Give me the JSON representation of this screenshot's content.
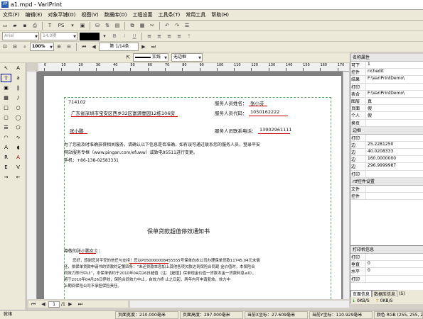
{
  "window": {
    "title": "a1.mpd - VariPrint",
    "icon": "VP"
  },
  "menu": [
    "文件(F)",
    "编辑(E)",
    "对象平铺(O)",
    "视图(V)",
    "数据库(D)",
    "工程设置",
    "工具条(T)",
    "常用工具",
    "帮助(H)"
  ],
  "font": {
    "name": "Arial",
    "size": "14.0磅"
  },
  "nav": {
    "zoom": "100%",
    "page": "第 1/14条"
  },
  "line": {
    "style": "实线",
    "border": "无边框"
  },
  "ruler_marks": [
    "0",
    "10",
    "20",
    "30",
    "40",
    "50",
    "60",
    "70",
    "80",
    "90",
    "100",
    "110",
    "120",
    "130",
    "140",
    "150",
    "160",
    "170"
  ],
  "document": {
    "postal": "714102",
    "address": "广东省深圳市宝安区西乡32区富源壹园12栋106房",
    "customer_name": "张小鹏",
    "service_name_label": "服务人员姓名：",
    "service_name": "张小芬",
    "service_code_label": "服务人员代码：",
    "service_code": "1050162222",
    "service_phone_label": "服务人员联系电话：",
    "service_phone": "13902961111",
    "notice_1": "为了您能及时准确获得相关服务，请确认以下信息是否准确，如有误可通过联系您的服务人员，登录平安",
    "notice_2": "网站服务专框（www.pingan.com/efuww）或致电95511进行变更。",
    "phone_line": "手机：+86-138-02583331",
    "heading": "保单贷款超值停效通知书",
    "salutation_prefix": "尊敬的",
    "salutation_name": "张小鹏",
    "salutation_suffix": "女士：",
    "body_1": "您好，感谢您对平安的信任与支持！您以P050000008455555号保单向本公司办理保单贷款11745.04元未偿",
    "body_2": "还，依保单贷款申请书的贷款约定第四条：“未还贷款本息加上其他各项欠款达到保险合同现 金价值时，本保险合",
    "body_3": "同效力即行中止”，本保单依约于2010年04月26日超值（注：【超值】保单现金价值一贷款本金一贷款利息≤0），",
    "body_4": "将于2010年04月26日停效，保险合同效力中止，自效力终 止之日起，两年内可申请复效，效力中",
    "body_5": "止期间保险公司不承担保险责任。"
  },
  "properties": {
    "section_name": "名称属性",
    "rows1": [
      {
        "k": "可下",
        "v": "1"
      },
      {
        "k": "控件",
        "v": "richedit"
      },
      {
        "k": "结果",
        "v": "F:\\VariPrintDemo\\"
      },
      {
        "k": "打印",
        "v": ""
      },
      {
        "k": "表合",
        "v": "F:\\VariPrintDemo\\"
      },
      {
        "k": "图层",
        "v": "真"
      },
      {
        "k": "页面",
        "v": "假"
      },
      {
        "k": "个人",
        "v": "假"
      },
      {
        "k": "换页",
        "v": ""
      }
    ],
    "section_border": "边框",
    "rows2": [
      {
        "k": "打印",
        "v": ""
      },
      {
        "k": "边",
        "v": "25.2281250"
      },
      {
        "k": "边",
        "v": "40.0208333"
      },
      {
        "k": "边",
        "v": "160.0000000"
      },
      {
        "k": "边",
        "v": "296.9999987"
      },
      {
        "k": "打印",
        "v": ""
      }
    ],
    "section_rtf": "rtf控件设置",
    "rows3": [
      {
        "k": "文件",
        "v": ""
      },
      {
        "k": "控件",
        "v": ""
      }
    ]
  },
  "print_panel": {
    "title": "打印机信息",
    "rows": [
      {
        "k": "打印",
        "v": ""
      },
      {
        "k": "垂直",
        "v": "0"
      },
      {
        "k": "水平",
        "v": "0"
      },
      {
        "k": "打印",
        "v": ""
      }
    ],
    "tabs": [
      "页面信息",
      "数据库信息",
      "(S)"
    ],
    "speeds": [
      "0KB/S",
      "0KB/S"
    ]
  },
  "page_nav": {
    "pos": "1",
    "total": "/1"
  },
  "status": {
    "ready": "就绪",
    "width": "页面宽度：210.000毫米",
    "height": "页面高度：297.000毫米",
    "x": "当前X坐标：27.609毫米",
    "y": "当前Y坐标：110.929毫米",
    "color": "颜色 RGB (255, 255, 255)"
  }
}
